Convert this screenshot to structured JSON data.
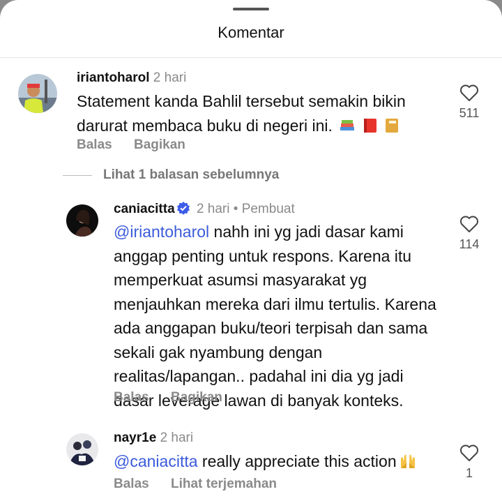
{
  "header": {
    "title": "Komentar"
  },
  "comments": [
    {
      "username": "iriantoharol",
      "time": "2 hari",
      "text": "Statement kanda Bahlil tersebut semakin bikin darurat membaca buku di negeri ini.",
      "emoji": [
        "books",
        "red-book",
        "notebook"
      ],
      "likes": "511",
      "actions": [
        "Balas",
        "Bagikan"
      ]
    },
    {
      "username": "caniacitta",
      "verified": true,
      "time": "2 hari",
      "separator": "•",
      "creator_label": "Pembuat",
      "mention": "@iriantoharol",
      "text_line1": " nahh ini yg jadi dasar kami",
      "text_rest": "anggap penting untuk respons. Karena itu memperkuat asumsi masyarakat yg menjauhkan mereka dari ilmu tertulis. Karena ada anggapan buku/teori terpisah dan sama sekali gak nyambung dengan realitas/lapangan.. padahal ini dia yg jadi dasar leverage lawan di banyak konteks.",
      "likes": "114",
      "actions": [
        "Balas",
        "Bagikan"
      ]
    },
    {
      "username": "nayr1e",
      "time": "2 hari",
      "mention": "@caniacitta",
      "text": " really appreciate this action",
      "emoji": [
        "raising-hands"
      ],
      "likes": "1",
      "actions": [
        "Balas",
        "Lihat terjemahan"
      ]
    }
  ],
  "replies_toggle": "Lihat 1 balasan sebelumnya"
}
